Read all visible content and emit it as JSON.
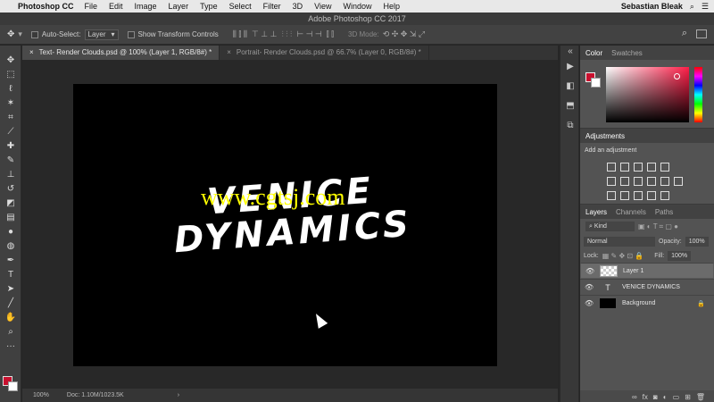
{
  "menubar": {
    "apple": "",
    "app_name": "Photoshop CC",
    "items": [
      "File",
      "Edit",
      "Image",
      "Layer",
      "Type",
      "Select",
      "Filter",
      "3D",
      "View",
      "Window",
      "Help"
    ],
    "user": "Sebastian Bleak"
  },
  "window_title": "Adobe Photoshop CC 2017",
  "options": {
    "auto_select_label": "Auto-Select:",
    "auto_select_target": "Layer",
    "show_transform_label": "Show Transform Controls",
    "mode_label": "3D Mode:"
  },
  "doc_tabs": [
    {
      "label": "Text- Render Clouds.psd @ 100% (Layer 1, RGB/8#) *"
    },
    {
      "label": "Portrait- Render Clouds.psd @ 66.7% (Layer 0, RGB/8#) *"
    }
  ],
  "canvas": {
    "line1": "VENICE",
    "line2": "DYNAMICS",
    "watermark": "www.cgtsj.com"
  },
  "status": {
    "zoom": "100%",
    "doc": "Doc: 1.10M/1023.5K",
    "arrow": "›"
  },
  "color_panel": {
    "tab_color": "Color",
    "tab_swatches": "Swatches",
    "foreground": "#c8102e",
    "background": "#ffffff"
  },
  "adjustments": {
    "title": "Adjustments",
    "hint": "Add an adjustment"
  },
  "layers": {
    "tab_layers": "Layers",
    "tab_channels": "Channels",
    "tab_paths": "Paths",
    "filter_kind": "Kind",
    "blend_mode": "Normal",
    "opacity_label": "Opacity:",
    "opacity_value": "100%",
    "lock_label": "Lock:",
    "fill_label": "Fill:",
    "fill_value": "100%",
    "items": [
      {
        "name": "Layer 1",
        "type": "pixel",
        "selected": true
      },
      {
        "name": "VENICE DYNAMICS",
        "type": "text",
        "selected": false
      },
      {
        "name": "Background",
        "type": "background",
        "selected": false
      }
    ],
    "footer_fx": "fx"
  }
}
